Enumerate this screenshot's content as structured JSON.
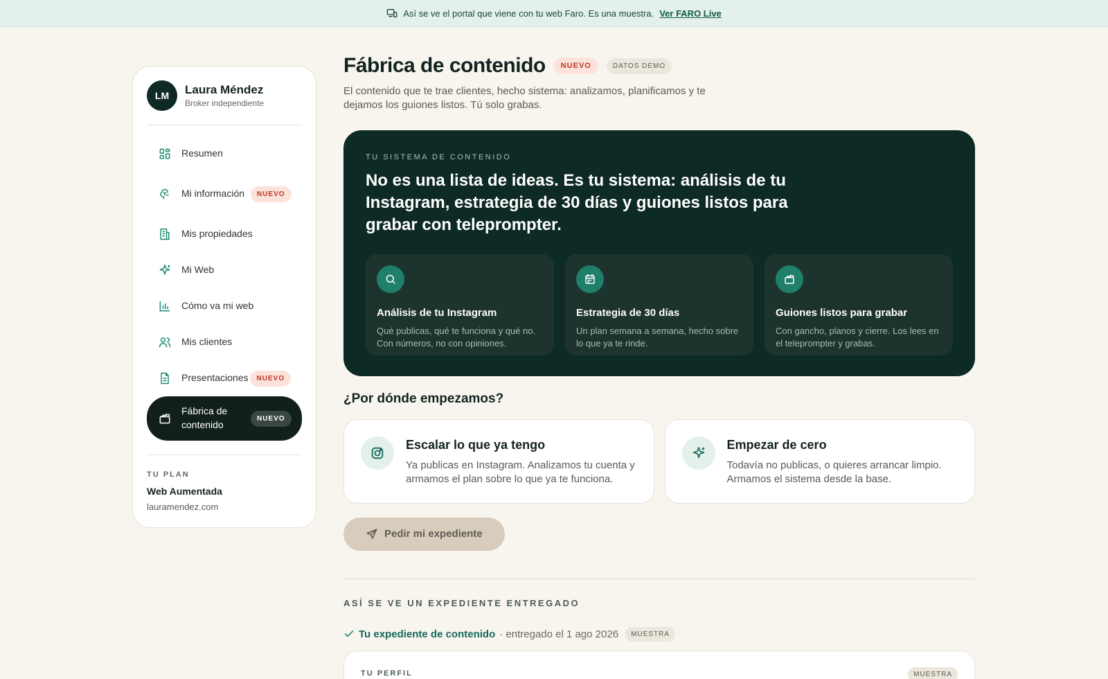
{
  "banner": {
    "text": "Así se ve el portal que viene con tu web Faro. Es una muestra.",
    "link": "Ver FARO Live",
    "icon": "monitor-phone-icon"
  },
  "sidebar": {
    "avatar_initials": "LM",
    "name": "Laura Méndez",
    "role": "Broker independiente",
    "items": [
      {
        "label": "Resumen",
        "icon": "grid-icon",
        "badge": ""
      },
      {
        "label": "Mi información",
        "icon": "brain-icon",
        "badge": "NUEVO"
      },
      {
        "label": "Mis propiedades",
        "icon": "building-icon",
        "badge": ""
      },
      {
        "label": "Mi Web",
        "icon": "sparkle-icon",
        "badge": ""
      },
      {
        "label": "Cómo va mi web",
        "icon": "bar-chart-icon",
        "badge": ""
      },
      {
        "label": "Mis clientes",
        "icon": "users-icon",
        "badge": ""
      },
      {
        "label": "Presentaciones",
        "icon": "document-icon",
        "badge": "NUEVO"
      },
      {
        "label": "Fábrica de contenido",
        "icon": "clapperboard-icon",
        "badge": "NUEVO",
        "active": true
      }
    ],
    "plan": {
      "label": "TU PLAN",
      "name": "Web Aumentada",
      "url": "lauramendez.com"
    }
  },
  "main": {
    "title": "Fábrica de contenido",
    "tag_new": "NUEVO",
    "tag_demo": "DATOS DEMO",
    "subtitle": "El contenido que te trae clientes, hecho sistema: analizamos, planificamos y te dejamos los guiones listos. Tú solo grabas.",
    "hero": {
      "kicker": "TU SISTEMA DE CONTENIDO",
      "title": "No es una lista de ideas. Es tu sistema: análisis de tu Instagram, estrategia de 30 días y guiones listos para grabar con teleprompter.",
      "cards": [
        {
          "icon": "search-icon",
          "title": "Análisis de tu Instagram",
          "desc": "Qué publicas, qué te funciona y qué no. Con números, no con opiniones."
        },
        {
          "icon": "calendar-icon",
          "title": "Estrategia de 30 días",
          "desc": "Un plan semana a semana, hecho sobre lo que ya te rinde."
        },
        {
          "icon": "clapperboard-icon",
          "title": "Guiones listos para grabar",
          "desc": "Con gancho, planos y cierre. Los lees en el teleprompter y grabas."
        }
      ]
    },
    "question": "¿Por dónde empezamos?",
    "choices": [
      {
        "icon": "instagram-icon",
        "title": "Escalar lo que ya tengo",
        "desc": "Ya publicas en Instagram. Analizamos tu cuenta y armamos el plan sobre lo que ya te funciona."
      },
      {
        "icon": "sparkle-icon",
        "title": "Empezar de cero",
        "desc": "Todavía no publicas, o quieres arrancar limpio. Armamos el sistema desde la base."
      }
    ],
    "cta": "Pedir mi expediente",
    "sample_label": "ASÍ SE VE UN EXPEDIENTE ENTREGADO",
    "delivered_title": "Tu expediente de contenido",
    "delivered_date": "· entregado el 1 ago 2026",
    "tag_sample": "MUESTRA",
    "profile_card_label": "TU PERFIL",
    "profile_card_tag": "MUESTRA"
  }
}
